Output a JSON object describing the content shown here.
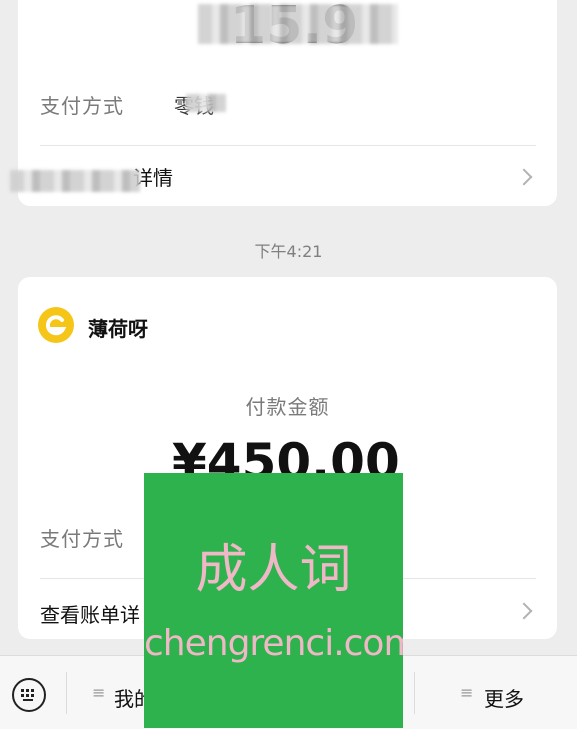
{
  "first_receipt": {
    "amount": "15.9",
    "pay_method_label": "支付方式",
    "pay_method_value": "零钱",
    "detail_link": "详情"
  },
  "timestamp": "下午4:21",
  "receipt": {
    "merchant_name": "薄荷呀",
    "title": "付款金额",
    "amount": "¥450.00",
    "pay_method_label": "支付方式",
    "bill_link": "查看账单详"
  },
  "bottom_menu": {
    "item1_label": "我的",
    "more_label": "更多"
  },
  "watermark": {
    "line1": "成人词",
    "line2": "chengrenci.com"
  },
  "colors": {
    "background": "#ededed",
    "card": "#ffffff",
    "merchant_logo": "#f5c518",
    "watermark_green": "#2eb24e",
    "watermark_text": "#f0b7c7"
  }
}
